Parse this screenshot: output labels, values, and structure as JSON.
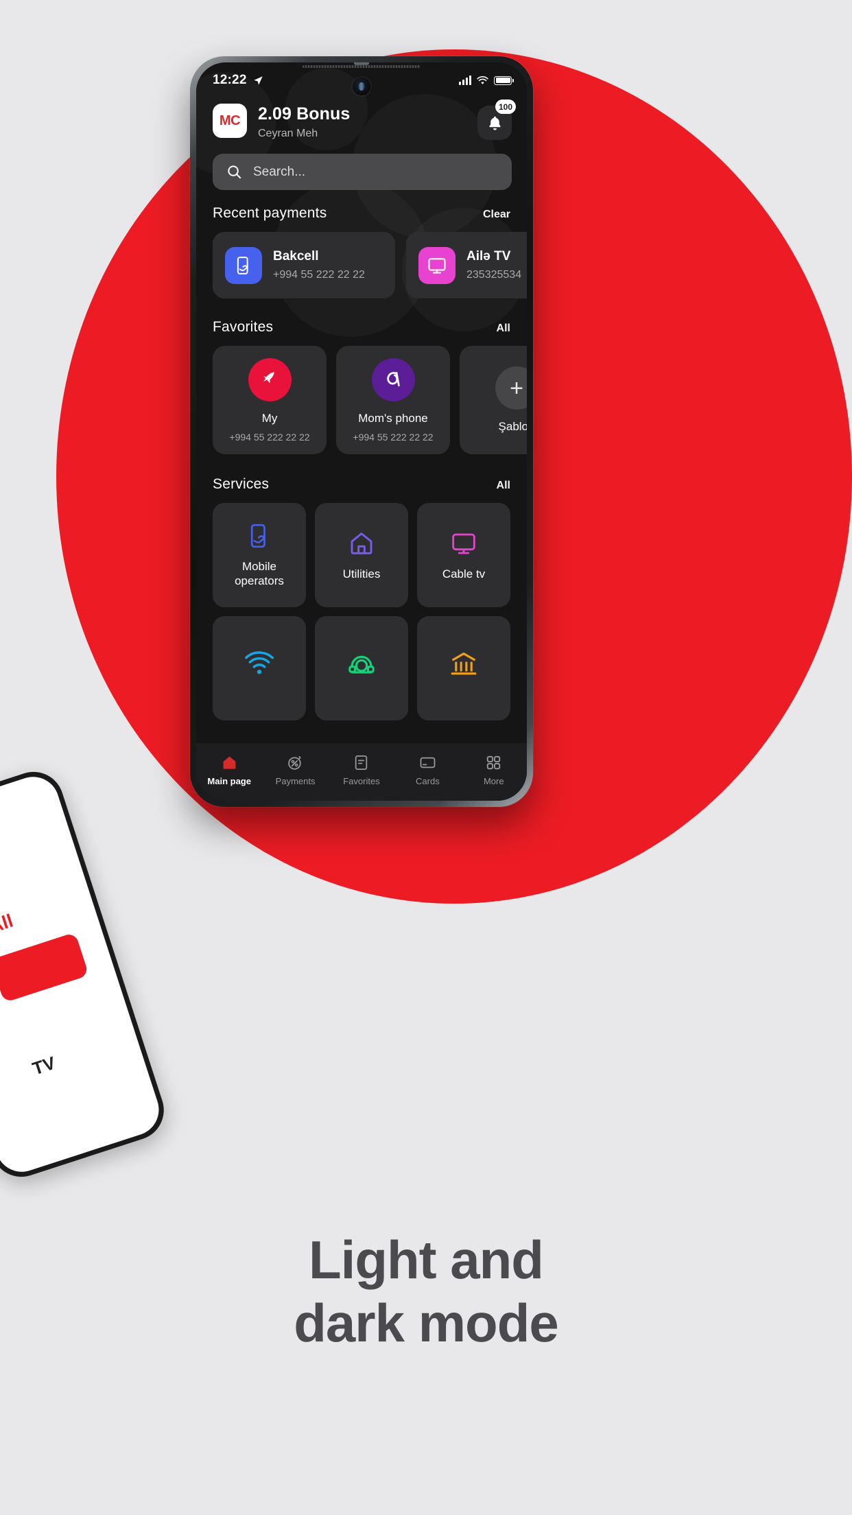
{
  "statusbar": {
    "time": "12:22",
    "location_icon": "location-arrow-icon",
    "signal_icon": "signal-bars-icon",
    "wifi_icon": "wifi-icon",
    "battery_icon": "battery-full-icon"
  },
  "header": {
    "avatar_initials": "MC",
    "bonus": "2.09 Bonus",
    "username": "Ceyran Meh",
    "bell_icon": "bell-icon",
    "bell_badge": "100"
  },
  "search": {
    "placeholder": "Search...",
    "icon": "search-icon"
  },
  "recent_payments": {
    "title": "Recent payments",
    "action": "Clear",
    "items": [
      {
        "name": "Bakcell",
        "number": "+994 55 222 22 22",
        "icon": "mobile-payment-icon",
        "color": "#4761ef"
      },
      {
        "name": "Ailə TV",
        "number": "235325534",
        "icon": "tv-icon",
        "color": "#e843d0"
      }
    ]
  },
  "favorites": {
    "title": "Favorites",
    "action": "All",
    "items": [
      {
        "name": "My",
        "number": "+994 55 222 22 22",
        "icon": "bakcell-bird-icon",
        "color": "#e8123a"
      },
      {
        "name": "Mom's phone",
        "number": "+994 55 222 22 22",
        "icon": "azercell-icon",
        "color": "#5c1e96"
      },
      {
        "name": "Şablon",
        "number": "",
        "icon": "plus-icon",
        "color": "#464649"
      }
    ]
  },
  "services": {
    "title": "Services",
    "action": "All",
    "items": [
      {
        "label": "Mobile\noperators",
        "icon": "mobile-operators-icon",
        "color": "#4761ef"
      },
      {
        "label": "Utilities",
        "icon": "home-icon",
        "color": "#7b5cf0"
      },
      {
        "label": "Cable tv",
        "icon": "tv-icon",
        "color": "#e843d0"
      },
      {
        "label": "",
        "icon": "wifi-internet-icon",
        "color": "#17a6e0"
      },
      {
        "label": "",
        "icon": "telephone-icon",
        "color": "#17d17a"
      },
      {
        "label": "",
        "icon": "bank-icon",
        "color": "#f0a11a"
      }
    ]
  },
  "tabbar": {
    "items": [
      {
        "label": "Main page",
        "icon": "home-icon",
        "active": true
      },
      {
        "label": "Payments",
        "icon": "payments-icon",
        "active": false
      },
      {
        "label": "Favorites",
        "icon": "document-icon",
        "active": false
      },
      {
        "label": "Cards",
        "icon": "card-icon",
        "active": false
      },
      {
        "label": "More",
        "icon": "grid-icon",
        "active": false
      }
    ]
  },
  "side_phone": {
    "all_label": "All",
    "tv_label": "TV"
  },
  "caption": {
    "line1": "Light and",
    "line2": "dark mode"
  },
  "colors": {
    "brand_red": "#ed1c24",
    "background": "#e8e8ea",
    "screen_bg": "#151516",
    "card_bg": "#2e2e30"
  }
}
